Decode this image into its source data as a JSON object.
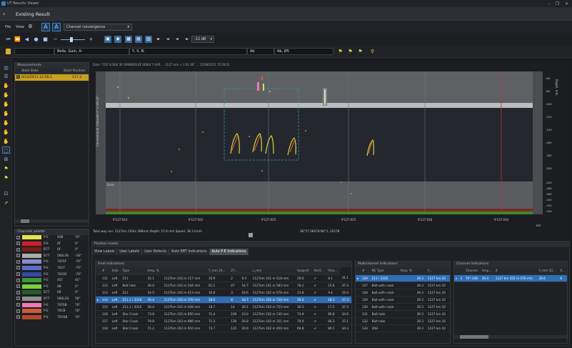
{
  "window": {
    "title": "UT Results Viewer",
    "min": "–",
    "restore": "❐",
    "close": "✕"
  },
  "header": {
    "back": "‹",
    "title": "Existing Result"
  },
  "toolbar1": {
    "file": "File",
    "view": "View",
    "dropdown": "Channel convergence",
    "dropdown_caret": "▾"
  },
  "toolbar2": {
    "db_dropdown": "-12 dB",
    "db_caret": "▾"
  },
  "toolbar3": {
    "field1": "",
    "field2": "Belle, Gain, A:",
    "field3": "Y, S, B:",
    "field4": "Ab",
    "field5": "Ab, Ø5"
  },
  "measurements": {
    "title": "Measurements",
    "headers": [
      "Start Date",
      "Start Position"
    ],
    "rows": [
      [
        "9/12/2011 12:28:3",
        "117,2"
      ]
    ]
  },
  "channels_panel": {
    "title": "Channels palette",
    "rows": [
      {
        "color": "#e8e24a",
        "code": "P-E",
        "name": "40B",
        "angle": "70°"
      },
      {
        "color": "#cc2222",
        "code": "P-E",
        "name": "0F",
        "angle": "0°"
      },
      {
        "color": "#7a1a1a",
        "code": "B77",
        "name": "0F",
        "angle": "0°"
      },
      {
        "color": "#aaaaaa",
        "code": "B77",
        "name": "58SLFB",
        "angle": "-58°"
      },
      {
        "color": "#8a8ad0",
        "code": "P-E",
        "name": "70FSF",
        "angle": "-70°"
      },
      {
        "color": "#5a70c8",
        "code": "P-E",
        "name": "70CF",
        "angle": "-70°"
      },
      {
        "color": "#3a48a0",
        "code": "P-E",
        "name": "70GSF",
        "angle": "-70°"
      },
      {
        "color": "#3a9a3a",
        "code": "P-E",
        "name": "45F",
        "angle": "45°"
      },
      {
        "color": "#7ad03a",
        "code": "P-E",
        "name": "0B",
        "angle": "0°"
      },
      {
        "color": "#2a5a2a",
        "code": "B77",
        "name": "0B",
        "angle": "0°"
      },
      {
        "color": "#909090",
        "code": "B77",
        "name": "58SLGS",
        "angle": "58°"
      },
      {
        "color": "#f07ab0",
        "code": "P-E",
        "name": "70FSB",
        "angle": "70°"
      },
      {
        "color": "#d05a3a",
        "code": "P-E",
        "name": "70CB",
        "angle": "70°"
      },
      {
        "color": "#b04a2a",
        "code": "P-E",
        "name": "70GSB",
        "angle": "70°"
      }
    ]
  },
  "plot": {
    "header": "Date: 7/20 %30/8 36 SPANNEN KÉ 008/8 7 HVR ... 1127 mm + 2 RL 90° ... 12/08/2011 15:28:31",
    "upper_label": "Conventional Channels 0°+/-80.02°",
    "lower_label": "Base",
    "right_label": "Depth, mm",
    "x_ticks": [
      "9'127.914",
      "9'127.922",
      "9'127.925",
      "9'127.925",
      "9'127.928",
      "9'127.934"
    ],
    "x_unit": "km",
    "y_ticks_upper": [
      "-60",
      "-80",
      "-100",
      "-120",
      "-140",
      "-160",
      "-180",
      "-200"
    ],
    "y_ticks_lower": [
      "-240",
      "-260",
      "-280",
      "-300",
      "-320",
      "-340"
    ],
    "status_left": "Total way run: 1127km 103m 388mm  Depth: 57.6 mm  Speed: 38.3 km/h",
    "status_right": "36°57.56A78 N4°1..20178"
  },
  "bottom": {
    "title": "Position marks",
    "tabs": [
      "View Labels",
      "User Labels",
      "User Defects",
      "Auto EBT Indications",
      "Auto P-E Indications"
    ],
    "active_tab": 4,
    "final": {
      "title": "Final Indications",
      "headers": [
        "#",
        "Side",
        "Type",
        "Amp, %",
        "",
        "Y_mm 10...",
        "27...",
        "",
        "L_mm",
        "Suspect",
        "Verif...",
        "Ymo..."
      ],
      "rows": [
        [
          "111",
          "Left",
          "211",
          "32.1",
          "1127km 103 m 117 mm",
          "10.9",
          "2",
          "9.5",
          "1127km 101 m 518 mm",
          "29.0",
          "✔",
          "8.1",
          "31.1"
        ],
        [
          "112",
          "Left",
          "Bolt hole",
          "36.4",
          "1127km 103 m 544 mm",
          "61.2",
          "47",
          "54.7",
          "1127km 101 m 583 mm",
          "78.2",
          "✔",
          "15.8",
          "37.3"
        ],
        [
          "113",
          "Left",
          "211",
          "34.5",
          "1127km 103 m 613 mm",
          "10.8",
          "3",
          "19.6",
          "1127km 102 m 578 mm",
          "23.8",
          "✔",
          "9.4",
          "15.4"
        ],
        [
          "114",
          "Left",
          "211.1 / 3316",
          "39.4",
          "1127km 103 m 576 mm",
          "28.6",
          "8",
          "18.7",
          "1127km 102 m 720 mm",
          "39.4",
          "✔",
          "18.3",
          "37.3"
        ],
        [
          "115",
          "Left",
          "211.1 / 3316",
          "36.4",
          "1127km 103 m 628 mm",
          "18.7",
          "14",
          "26.1",
          "1127km 102 m 733 mm",
          "36.3",
          "✔",
          "17.5",
          "37.3"
        ],
        [
          "116",
          "Left",
          "Star Crack",
          "73.8",
          "1127km 103 m 850 mm",
          "71.4",
          "100",
          "23.0",
          "1127km 102 m 130 mm",
          "73.9",
          "✔",
          "85.8",
          "34.6"
        ],
        [
          "117",
          "Left",
          "Star Crack",
          "79.8",
          "1127km 103 m 889 mm",
          "71.3",
          "130",
          "26.8",
          "1127km 102 m 151 mm",
          "79.0",
          "✔",
          "66.3",
          "37.1"
        ],
        [
          "118",
          "Left",
          "Star Crack",
          "71.2",
          "1127km 103 m 910 mm",
          "73.7",
          "125",
          "20.9",
          "1127km 102 m 350 mm",
          "69.8",
          "✔",
          "80.1",
          "34.3"
        ]
      ],
      "selected": 3
    },
    "multi": {
      "title": "Multichannel Indications",
      "headers": [
        "#",
        "NC Type",
        "Amp, %",
        "",
        "Y..."
      ],
      "rows": [
        [
          "126",
          "211 / 3320",
          "",
          "39.3",
          "1127 km 10"
        ],
        [
          "127",
          "Bolt with crack",
          "",
          "39.3",
          "1127 km 10"
        ],
        [
          "128",
          "Bolt with crack",
          "",
          "39.3",
          "1127 km 10"
        ],
        [
          "129",
          "Bolt with crack",
          "",
          "39.3",
          "1127 km 10"
        ],
        [
          "130",
          "Bolt with crack",
          "",
          "39.3",
          "1127 km 10"
        ],
        [
          "131",
          "Bolt hole",
          "",
          "39.3",
          "1127 km 10"
        ],
        [
          "132",
          "Bolt hole",
          "",
          "39.3",
          "1127 km 10"
        ],
        [
          "133",
          "20H",
          "",
          "39.3",
          "1127 km 10"
        ]
      ],
      "selected": 0
    },
    "channel": {
      "title": "Channel Indications",
      "headers": [
        "",
        "Channel",
        "Amp...",
        "X",
        "Y_mm 10...",
        "X..."
      ],
      "rows": [
        [
          "1",
          "70°-10B",
          "39.4",
          "1127 km 102 m 576 mm",
          "28.6",
          "8"
        ]
      ],
      "selected": 0
    }
  }
}
